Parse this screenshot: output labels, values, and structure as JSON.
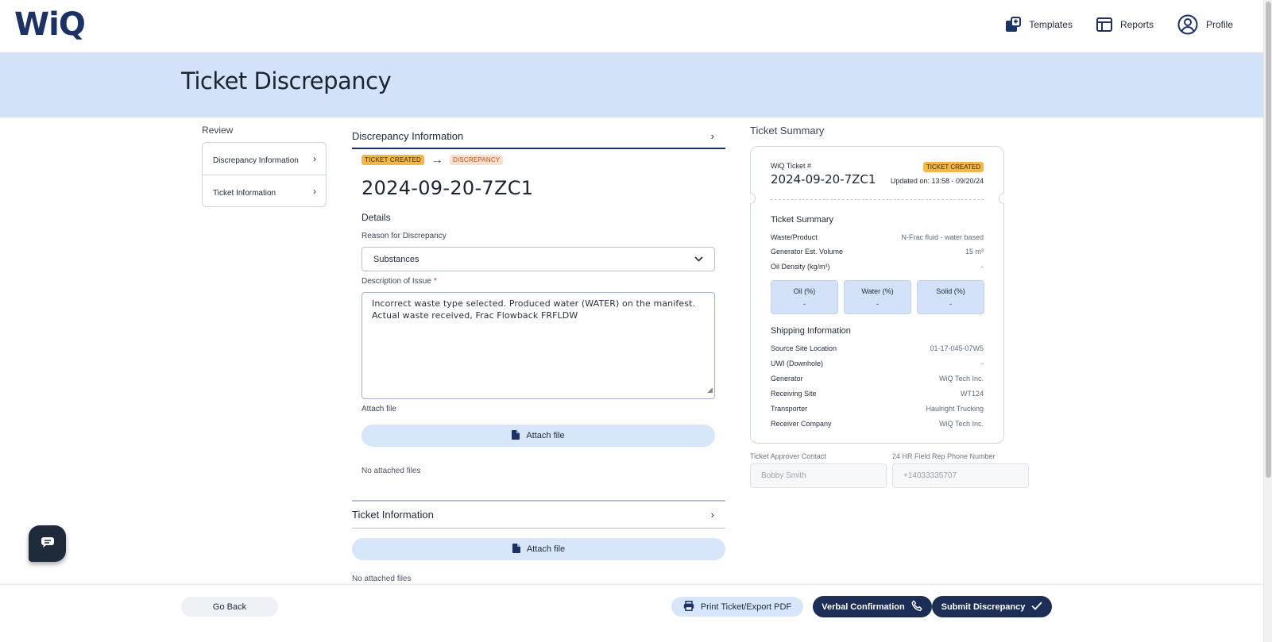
{
  "app": {
    "logo": "WiQ"
  },
  "nav": [
    {
      "label": "Templates",
      "icon": "templates-icon"
    },
    {
      "label": "Reports",
      "icon": "reports-icon"
    },
    {
      "label": "Profile",
      "icon": "profile-icon"
    }
  ],
  "page": {
    "title": "Ticket Discrepancy"
  },
  "review": {
    "title": "Review",
    "items": [
      {
        "label": "Discrepancy Information"
      },
      {
        "label": "Ticket Information"
      }
    ]
  },
  "discrepancy": {
    "section_title": "Discrepancy Information",
    "status_from": "TICKET CREATED",
    "status_to": "DISCREPANCY",
    "ticket_number": "2024-09-20-7ZC1",
    "details_label": "Details",
    "reason_label": "Reason for Discrepancy",
    "reason_value": "Substances",
    "description_label": "Description of Issue",
    "description_required": "*",
    "description_value": "Incorrect waste type selected. Produced water (WATER) on the manifest. Actual waste received, Frac Flowback FRFLDW",
    "attach_label": "Attach file",
    "attach_button": "Attach file",
    "no_files": "No attached files"
  },
  "ticket_info": {
    "section_title": "Ticket Information",
    "attach_button": "Attach file",
    "no_files": "No attached files"
  },
  "summary": {
    "title": "Ticket Summary",
    "ticket_label": "WiQ Ticket #",
    "status_badge": "TICKET CREATED",
    "ticket_number": "2024-09-20-7ZC1",
    "updated": "Updated on: 13:58 - 09/20/24",
    "section1": "Ticket Summary",
    "rows1": [
      {
        "k": "Waste/Product",
        "v": "N-Frac fluid - water based"
      },
      {
        "k": "Generator Est. Volume",
        "v": "15 m³"
      },
      {
        "k": "Oil Density (kg/m³)",
        "v": "-"
      }
    ],
    "percent": [
      {
        "label": "Oil (%)",
        "value": "-"
      },
      {
        "label": "Water (%)",
        "value": "-"
      },
      {
        "label": "Solid (%)",
        "value": "-"
      }
    ],
    "section2": "Shipping Information",
    "rows2": [
      {
        "k": "Source Site Location",
        "v": "01-17-045-07W5"
      },
      {
        "k": "UWI (Downhole)",
        "v": "-"
      },
      {
        "k": "Generator",
        "v": "WiQ Tech Inc."
      },
      {
        "k": "Receiving Site",
        "v": "WT124"
      },
      {
        "k": "Transporter",
        "v": "Haulright Trucking"
      },
      {
        "k": "Receiver Company",
        "v": "WiQ Tech Inc."
      }
    ]
  },
  "contacts": {
    "approver_label": "Ticket Approver Contact",
    "approver_value": "Bobby Smith",
    "phone_label": "24 HR Field Rep Phone Number",
    "phone_value": "+14033335707"
  },
  "footer": {
    "go_back": "Go Back",
    "print": "Print Ticket/Export PDF",
    "verbal": "Verbal Confirmation",
    "submit": "Submit Discrepancy"
  },
  "colors": {
    "brand": "#1c3264",
    "banner": "#d4e2f9",
    "badge_created": "#f3b64a",
    "badge_discrepancy": "#fbe0d0",
    "primary_button": "#1c2e55"
  }
}
